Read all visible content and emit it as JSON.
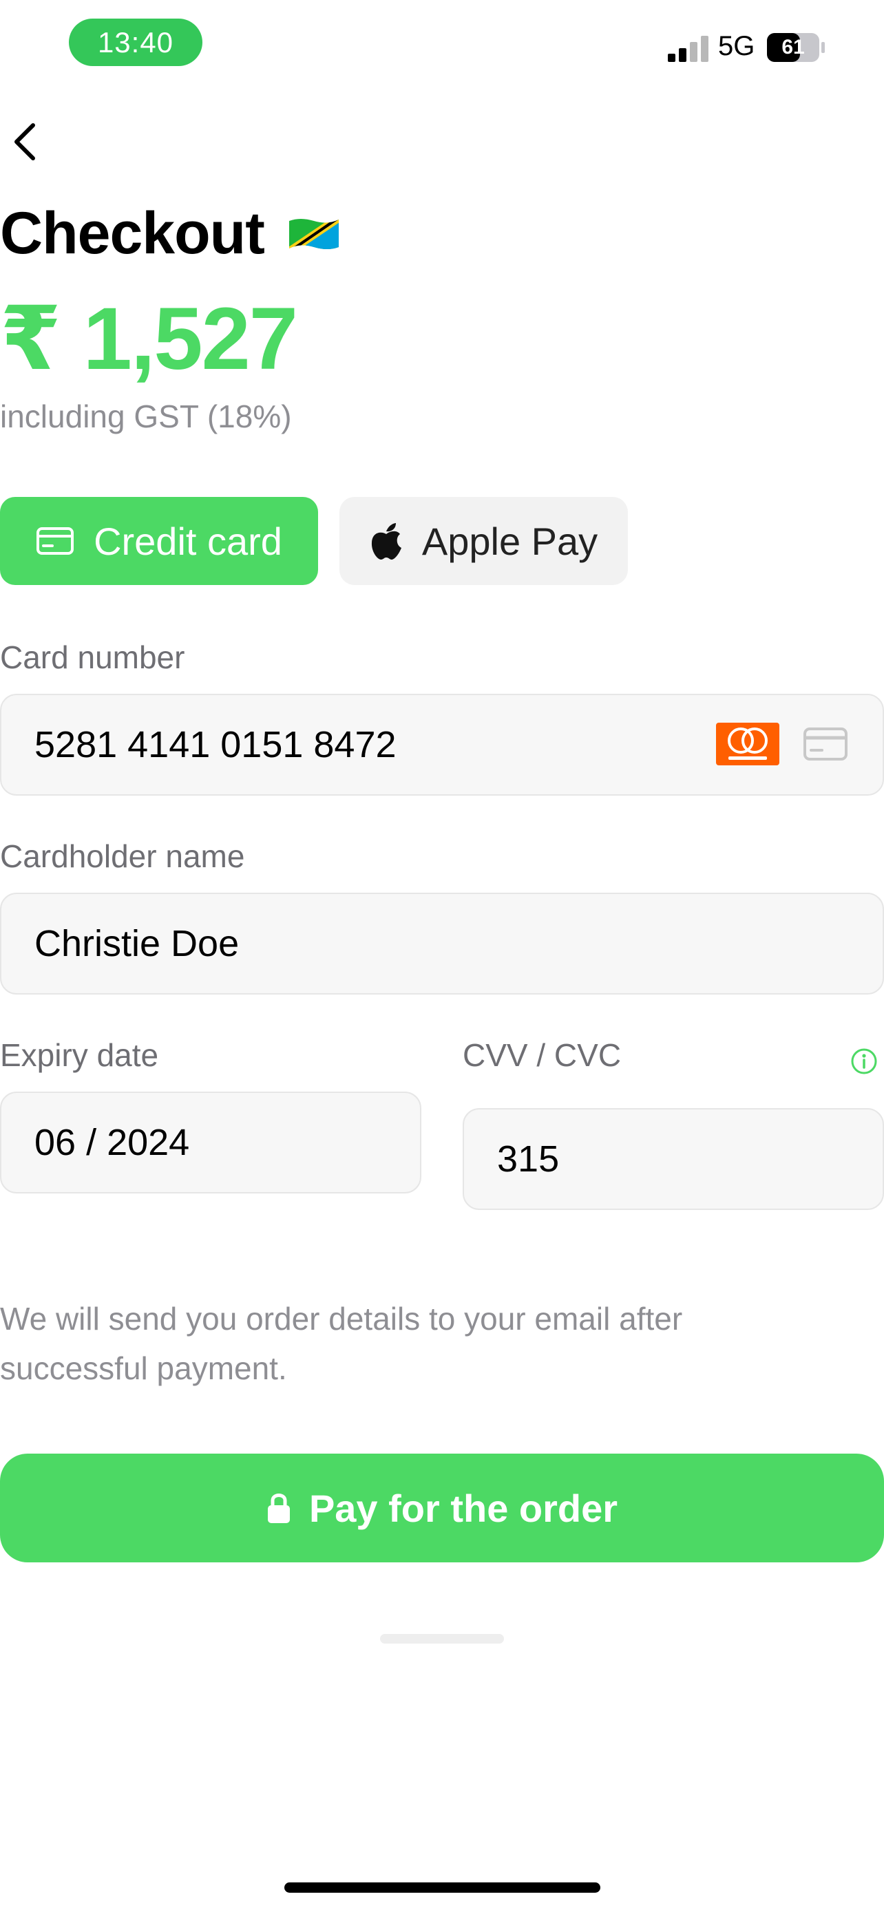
{
  "status_bar": {
    "time": "13:40",
    "network": "5G",
    "battery": "61"
  },
  "header": {
    "title": "Checkout",
    "flag_icon": "tanzania-flag"
  },
  "price": {
    "amount": "₹ 1,527",
    "tax_note": "including GST (18%)"
  },
  "payment_methods": [
    {
      "label": "Credit card",
      "icon": "credit-card-icon",
      "selected": true
    },
    {
      "label": "Apple Pay",
      "icon": "apple-icon",
      "selected": false
    }
  ],
  "form": {
    "card_number": {
      "label": "Card number",
      "value": "5281 4141 0151 8472",
      "brand": "mastercard"
    },
    "cardholder": {
      "label": "Cardholder name",
      "value": "Christie Doe"
    },
    "expiry": {
      "label": "Expiry date",
      "value": "06 / 2024"
    },
    "cvv": {
      "label": "CVV / CVC",
      "value": "315"
    }
  },
  "notice": "We will send you order details to your email after successful payment.",
  "cta": {
    "label": "Pay for the order"
  },
  "colors": {
    "accent": "#4cd964",
    "field_bg": "#f7f7f7",
    "muted": "#8e8e93"
  }
}
